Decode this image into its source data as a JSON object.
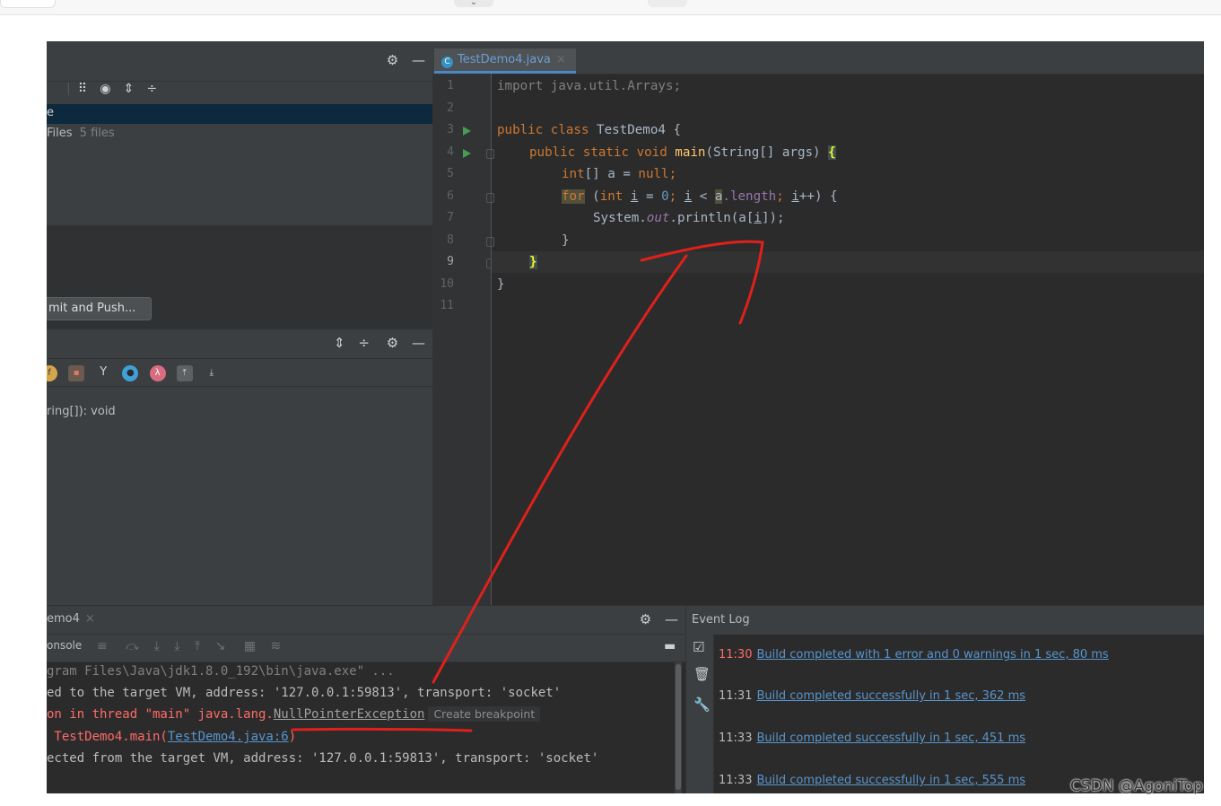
{
  "browser": {
    "chevron_icon": "chevron-down-icon"
  },
  "project_panel": {
    "toolbar_icons": [
      "gear-icon",
      "minimize-icon",
      "group-icon",
      "eye-icon",
      "expand-all-icon",
      "collapse-all-icon"
    ],
    "selected_text": "e",
    "files_label": "Files",
    "files_count": "5 files",
    "commit_push_label": "mit and Push..."
  },
  "structure_panel": {
    "toolbar_icons": [
      "expand-all-icon",
      "collapse-all-icon",
      "gear-icon",
      "minimize-icon"
    ],
    "filter_icons": [
      "field-filter-icon",
      "lock-icon",
      "inherited-icon",
      "circle-icon",
      "lambda-icon",
      "sort-up-icon",
      "sort-down-icon"
    ],
    "item_label": "ring[]): void"
  },
  "editor": {
    "tab_label": "TestDemo4.java",
    "line_numbers": [
      "1",
      "2",
      "3",
      "4",
      "5",
      "6",
      "7",
      "8",
      "9",
      "10",
      "11"
    ],
    "code": {
      "l1": "import java.util.Arrays;",
      "l3_kw": "public class",
      "l3_name": " TestDemo4 {",
      "l4_kw": "public static void",
      "l4_fn": "main",
      "l4_rest": "(String[] args) ",
      "l4_brace": "{",
      "l5_kw": "int",
      "l5_mid": "[] a = ",
      "l5_null": "null",
      "l5_end": ";",
      "l6_for": "for",
      "l6_p1": " (",
      "l6_int": "int",
      "l6_i1": "i",
      "l6_eq": " = ",
      "l6_zero": "0",
      "l6_semi": ";",
      "l6_i2": "i",
      "l6_lt": " < ",
      "l6_a": "a",
      "l6_len": ".length",
      "l6_semi2": ";",
      "l6_i3": "i",
      "l6_end": "++) {",
      "l7_sys": "System.",
      "l7_out": "out",
      "l7_println": ".println(a[",
      "l7_i": "i",
      "l7_end": "]);",
      "l8": "}",
      "l9": "}",
      "l10": "}"
    }
  },
  "run_panel": {
    "tab_label": "emo4",
    "console_tab": "onsole",
    "lines": {
      "l1": "gram Files\\Java\\jdk1.8.0_192\\bin\\java.exe\" ...",
      "l2": "ed to the target VM, address: '127.0.0.1:59813', transport: 'socket'",
      "l3_a": "on in thread \"main\" java.lang.",
      "l3_exc": "NullPointerException",
      "l3_bp": "Create breakpoint",
      "l4_a": " TestDemo4.main(",
      "l4_link": "TestDemo4.java:6",
      "l4_b": ")",
      "l5": "ected from the target VM, address: '127.0.0.1:59813', transport: 'socket'"
    }
  },
  "event_log": {
    "title": "Event Log",
    "side_icons": [
      "checkbox-icon",
      "trash-icon",
      "wrench-icon"
    ],
    "entries": [
      {
        "time": "11:30",
        "text": "Build completed with 1 error and 0 warnings in 1 sec, 80 ms",
        "error": true
      },
      {
        "time": "11:31",
        "text": "Build completed successfully in 1 sec, 362 ms",
        "error": false
      },
      {
        "time": "11:33",
        "text": "Build completed successfully in 1 sec, 451 ms",
        "error": false
      },
      {
        "time": "11:33",
        "text": "Build completed successfully in 1 sec, 555 ms",
        "error": false
      }
    ]
  },
  "watermark": "CSDN @AgoniTop",
  "colors": {
    "annotation": "#e0201b",
    "link": "#5895ce",
    "error": "#ff6b68",
    "keyword": "#cc7832"
  }
}
